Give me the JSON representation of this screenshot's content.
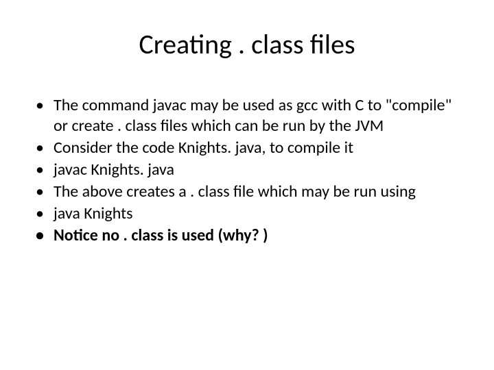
{
  "title": "Creating . class files",
  "bullets": [
    {
      "text": "The command javac may be used as gcc with C to \"compile\" or create . class files which can be run by the JVM",
      "bold": false
    },
    {
      "text": "Consider the code Knights. java, to compile it",
      "bold": false
    },
    {
      "text": "javac Knights. java",
      "bold": false
    },
    {
      "text": "The above creates a . class file which may be run using",
      "bold": false
    },
    {
      "text": "java Knights",
      "bold": false
    },
    {
      "text": "Notice no . class is used (why? )",
      "bold": true
    }
  ]
}
